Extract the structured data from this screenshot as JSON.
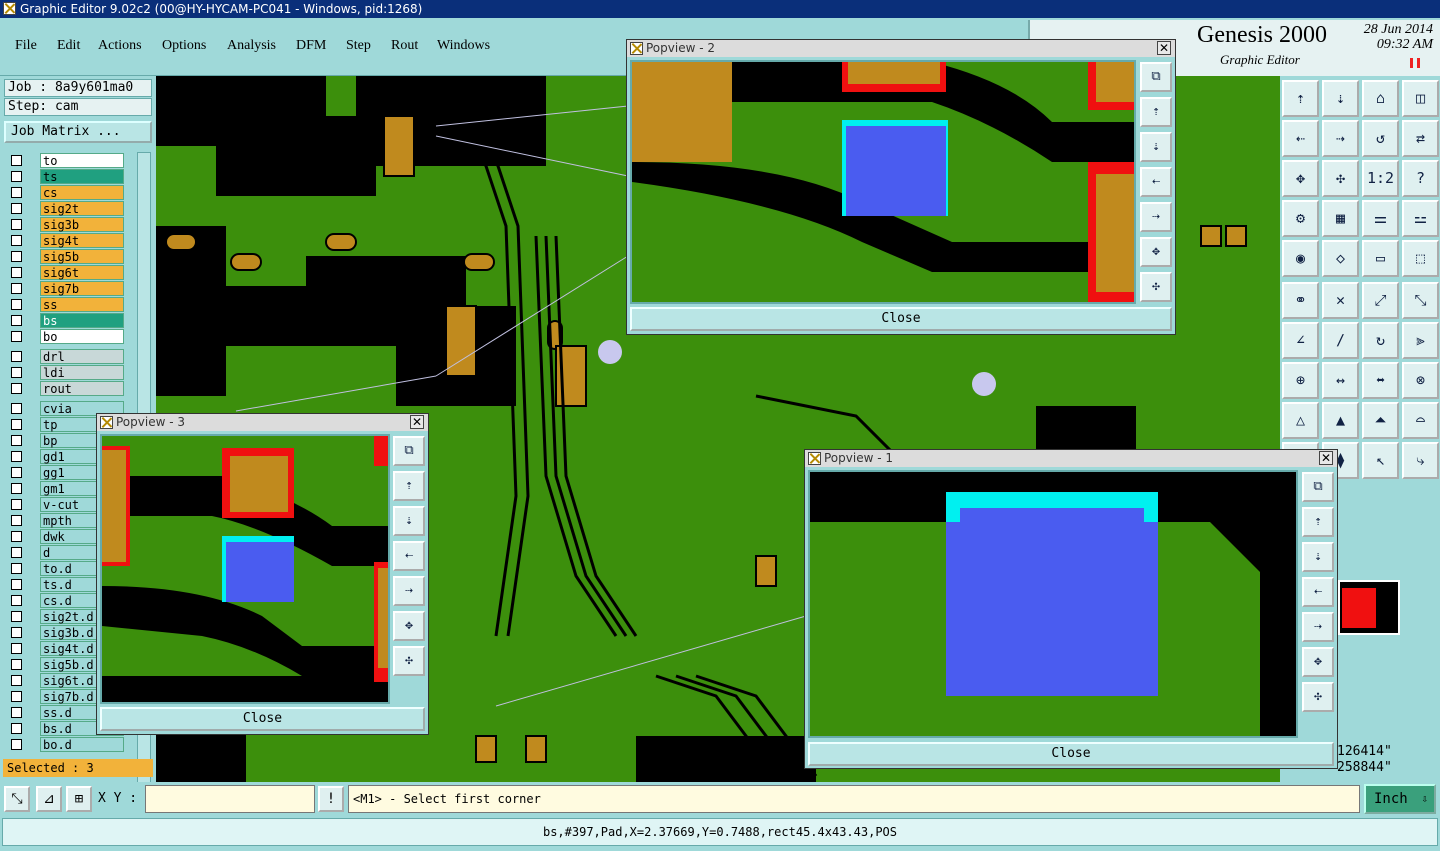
{
  "window": {
    "title": "Graphic Editor 9.02c2 (00@HY-HYCAM-PC041 - Windows, pid:1268)"
  },
  "menu": {
    "items": [
      "File",
      "Edit",
      "Actions",
      "Options",
      "Analysis",
      "DFM",
      "Step",
      "Rout",
      "Windows"
    ]
  },
  "brand": {
    "name": "Genesis 2000",
    "subtitle": "Graphic Editor",
    "date": "28 Jun 2014",
    "time": "09:32 AM"
  },
  "job": {
    "job_label": "Job : 8a9y601ma0",
    "step_label": "Step: cam",
    "matrix_button": "Job Matrix ..."
  },
  "layers": [
    "to",
    "ts",
    "cs",
    "sig2t",
    "sig3b",
    "sig4t",
    "sig5b",
    "sig6t",
    "sig7b",
    "ss",
    "bs",
    "bo",
    "drl",
    "ldi",
    "rout",
    "cvia",
    "tp",
    "bp",
    "gd1",
    "gg1",
    "gm1",
    "v-cut",
    "mpth",
    "dwk",
    "d",
    "to.d",
    "ts.d",
    "cs.d",
    "sig2t.d",
    "sig3b.d",
    "sig4t.d",
    "sig5b.d",
    "sig6t.d",
    "sig7b.d",
    "ss.d",
    "bs.d",
    "bo.d"
  ],
  "selected_count": "Selected : 3",
  "popups": {
    "p1": {
      "title": "Popview - 1",
      "close": "Close"
    },
    "p2": {
      "title": "Popview - 2",
      "close": "Close"
    },
    "p3": {
      "title": "Popview - 3",
      "close": "Close"
    }
  },
  "readouts": {
    "x": "126414\"",
    "y": "258844\""
  },
  "bottom": {
    "xy_label": "X Y :",
    "xy_value": "",
    "prompt": "<M1> - Select first corner",
    "units": "Inch"
  },
  "status": "bs,#397,Pad,X=2.37669,Y=0.7488,rect45.4x43.43,POS",
  "colors": {
    "board": "#3c8f0c",
    "copper": "#c08a1e",
    "mask": "#000000",
    "highlight": "#4a5cf0",
    "cyan": "#00f0f0",
    "red": "#f01010"
  }
}
